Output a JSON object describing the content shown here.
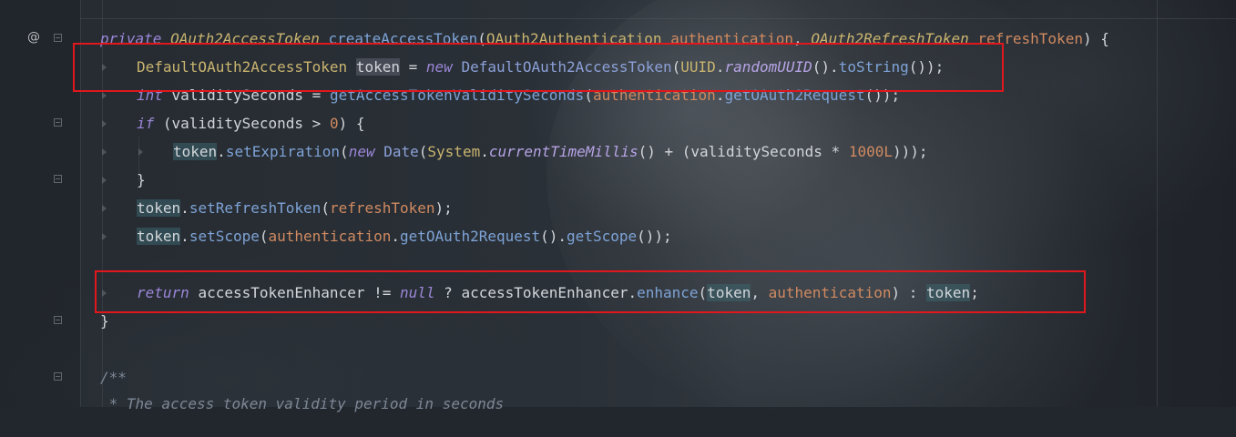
{
  "editor": {
    "annotation_symbol": "@",
    "lines": {
      "l1": {
        "kw_private": "private",
        "type_return": "OAuth2AccessToken",
        "method_name": "createAccessToken",
        "paren_open": "(",
        "type_p1": "OAuth2Authentication",
        "param1": "authentication",
        "comma": ",",
        "type_p2": "OAuth2RefreshToken",
        "param2": "refreshToken",
        "close": ") {"
      },
      "l2": {
        "type": "DefaultOAuth2AccessToken",
        "var": "token",
        "eq": " = ",
        "kw_new": "new",
        "ctor": "DefaultOAuth2AccessToken",
        "p_open": "(",
        "uuid": "UUID",
        "dot1": ".",
        "random": "randomUUID",
        "call1": "().",
        "tostring": "toString",
        "end": "());"
      },
      "l3": {
        "kw_int": "int",
        "var": "validitySeconds",
        "eq": " = ",
        "method": "getAccessTokenValiditySeconds",
        "p_open": "(",
        "param": "authentication",
        "dot": ".",
        "method2": "getOAuth2Request",
        "end": "());"
      },
      "l4": {
        "kw_if": "if",
        "open": " (",
        "var": "validitySeconds",
        "op": " > ",
        "num": "0",
        "close": ") {"
      },
      "l5": {
        "var": "token",
        "dot": ".",
        "method": "setExpiration",
        "p_open": "(",
        "kw_new": "new",
        "cls": "Date",
        "p2": "(",
        "system": "System",
        "dot2": ".",
        "static": "currentTimeMillis",
        "mid": "() + (",
        "var2": "validitySeconds",
        "op": " * ",
        "num": "1000L",
        "end": ")));"
      },
      "l6": {
        "brace": "}"
      },
      "l7": {
        "var": "token",
        "dot": ".",
        "method": "setRefreshToken",
        "p_open": "(",
        "param": "refreshToken",
        "end": ");"
      },
      "l8": {
        "var": "token",
        "dot": ".",
        "method": "setScope",
        "p_open": "(",
        "param": "authentication",
        "dot2": ".",
        "method2": "getOAuth2Request",
        "call": "().",
        "method3": "getScope",
        "end": "());"
      },
      "l10": {
        "kw_return": "return",
        "field": "accessTokenEnhancer",
        "op": " != ",
        "kw_null": "null",
        "q": " ? ",
        "field2": "accessTokenEnhancer",
        "dot": ".",
        "method": "enhance",
        "p_open": "(",
        "var": "token",
        "comma": ", ",
        "param": "authentication",
        "colon": ") : ",
        "var2": "token",
        "semi": ";"
      },
      "l11": {
        "brace": "}"
      },
      "l13": {
        "comment": "/**"
      },
      "l14": {
        "comment": " * The access token validity period in seconds"
      }
    }
  }
}
